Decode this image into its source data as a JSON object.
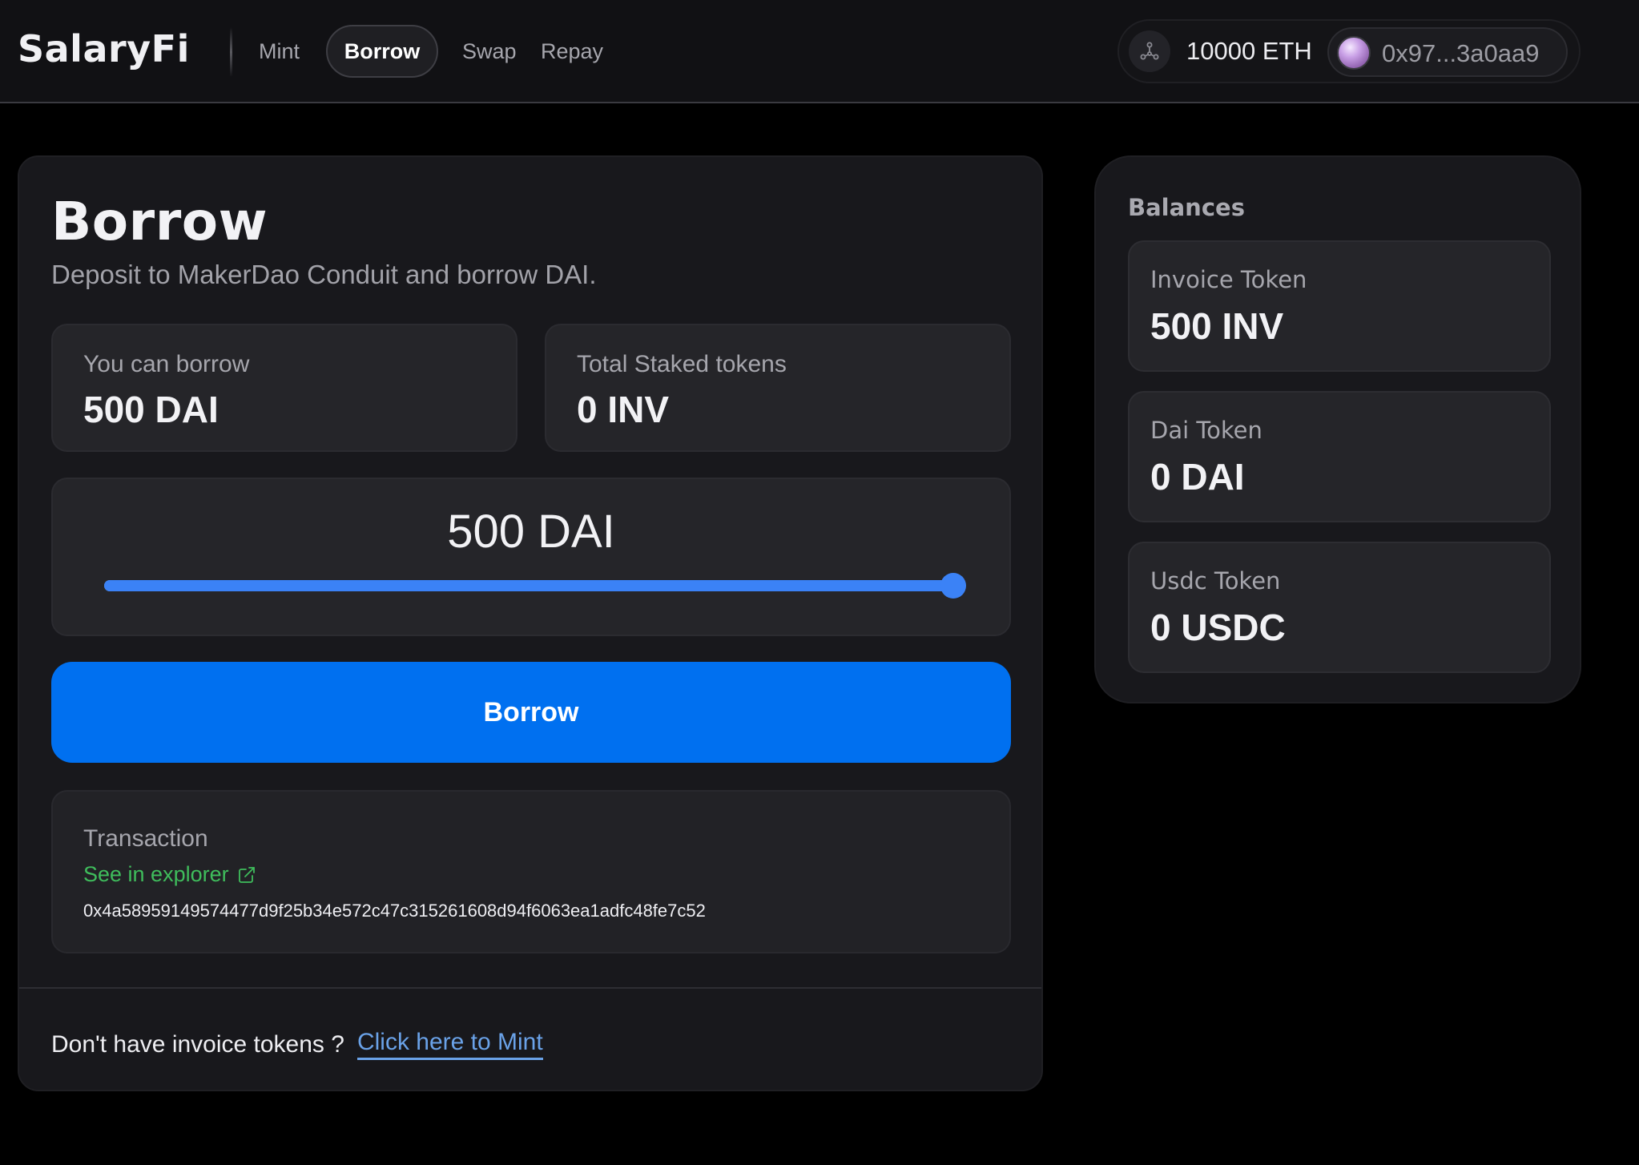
{
  "header": {
    "logo": "SalaryFi",
    "nav": [
      {
        "label": "Mint",
        "active": false
      },
      {
        "label": "Borrow",
        "active": true
      },
      {
        "label": "Swap",
        "active": false
      },
      {
        "label": "Repay",
        "active": false
      }
    ],
    "network_icon": "network-nodes-icon",
    "eth_balance": "10000 ETH",
    "wallet_address": "0x97...3a0aa9"
  },
  "main": {
    "title": "Borrow",
    "subtitle": "Deposit to MakerDao Conduit and borrow DAI.",
    "stats": [
      {
        "label": "You can borrow",
        "value": "500 DAI"
      },
      {
        "label": "Total Staked tokens",
        "value": "0 INV"
      }
    ],
    "slider": {
      "amount_label": "500 DAI",
      "value": 500,
      "max": 500,
      "fill_fraction": 1.0,
      "color": "#3b82f6"
    },
    "borrow_button_label": "Borrow",
    "transaction": {
      "label": "Transaction",
      "explorer_link": "See in explorer",
      "hash": "0x4a58959149574477d9f25b34e572c47c315261608d94f6063ea1adfc48fe7c52"
    },
    "footer": {
      "prompt": "Don't have invoice tokens ?",
      "link": "Click here to Mint"
    }
  },
  "balances": {
    "title": "Balances",
    "items": [
      {
        "label": "Invoice Token",
        "value": "500 INV"
      },
      {
        "label": "Dai Token",
        "value": "0 DAI"
      },
      {
        "label": "Usdc Token",
        "value": "0 USDC"
      }
    ]
  },
  "colors": {
    "accent": "#0070f0",
    "link_green": "#3fbd5c",
    "link_blue": "#6aa2e8"
  }
}
